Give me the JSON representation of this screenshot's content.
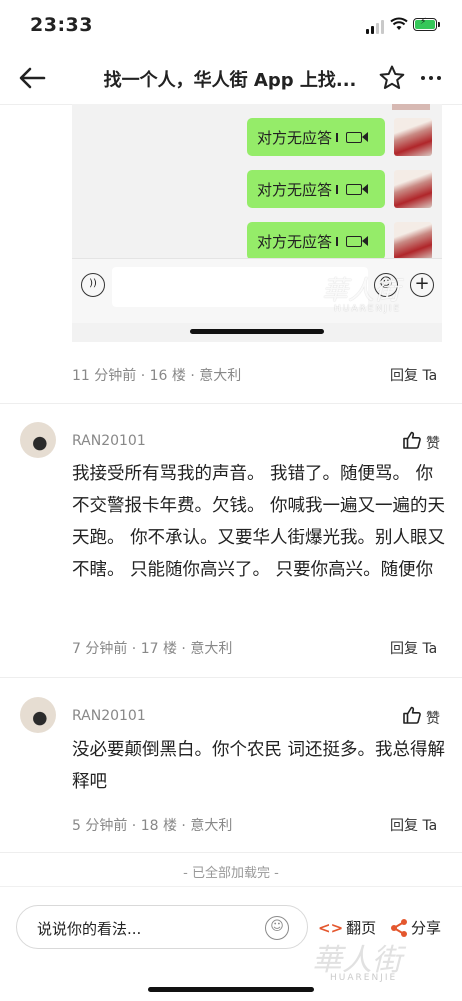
{
  "status": {
    "time": "23:33"
  },
  "nav": {
    "title": "找一个人，华人街 App 上找..."
  },
  "embed": {
    "bubbles": [
      "对方无应答",
      "对方无应答",
      "对方无应答"
    ],
    "watermark": "華人街",
    "watermark_sub": "HUARENJIE"
  },
  "posts": [
    {
      "meta": "11 分钟前 · 16 楼 · 意大利",
      "reply": "回复 Ta"
    },
    {
      "user": "RAN20101",
      "like": "赞",
      "content": "我接受所有骂我的声音。  我错了。随便骂。  你不交警报卡年费。欠钱。  你喊我一遍又一遍的天天跑。  你不承认。又要华人街爆光我。别人眼又不瞎。  只能随你高兴了。 只要你高兴。随便你",
      "meta": "7 分钟前 · 17 楼 · 意大利",
      "reply": "回复 Ta"
    },
    {
      "user": "RAN20101",
      "like": "赞",
      "content": "没必要颠倒黑白。你个农民  词还挺多。我总得解释吧",
      "meta": "5 分钟前 · 18 楼 · 意大利",
      "reply": "回复 Ta"
    }
  ],
  "footer": {
    "loaded": "- 已全部加载完 -"
  },
  "bottombar": {
    "placeholder": "说说你的看法...",
    "page_label": "翻页",
    "share_label": "分享",
    "watermark": "華人街",
    "watermark_sub": "HUARENJIE"
  },
  "colors": {
    "accent": "#e4572e",
    "bubble": "#95ec69"
  }
}
